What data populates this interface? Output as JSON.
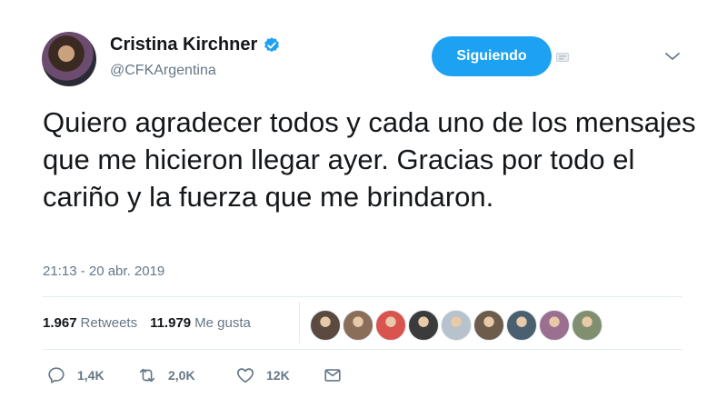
{
  "author": {
    "display_name": "Cristina Kirchner",
    "handle": "@CFKArgentina",
    "verified": true
  },
  "follow_button": {
    "label": "Siguiendo"
  },
  "tweet": {
    "text": "Quiero agradecer todos y cada uno de los mensajes que me hicieron llegar ayer. Gracias por todo el cariño y la fuerza que me brindaron.",
    "timestamp": "21:13 - 20 abr. 2019"
  },
  "stats": {
    "retweets_count": "1.967",
    "retweets_label": "Retweets",
    "likes_count": "11.979",
    "likes_label": "Me gusta"
  },
  "liker_avatars": [
    {
      "color": "#5a4a3f"
    },
    {
      "color": "#8b6e5a"
    },
    {
      "color": "#d9534f"
    },
    {
      "color": "#3b3b3b"
    },
    {
      "color": "#b8c2cc"
    },
    {
      "color": "#6d5b4b"
    },
    {
      "color": "#4a6070"
    },
    {
      "color": "#9b6f8f"
    },
    {
      "color": "#7f8f6f"
    }
  ],
  "actions": {
    "reply": {
      "icon": "reply-icon",
      "count": "1,4K"
    },
    "retweet": {
      "icon": "retweet-icon",
      "count": "2,0K"
    },
    "like": {
      "icon": "heart-icon",
      "count": "12K"
    },
    "message": {
      "icon": "envelope-icon"
    }
  },
  "colors": {
    "accent": "#1da1f2",
    "text": "#14171a",
    "muted": "#657786",
    "border": "#e6ecf0"
  }
}
